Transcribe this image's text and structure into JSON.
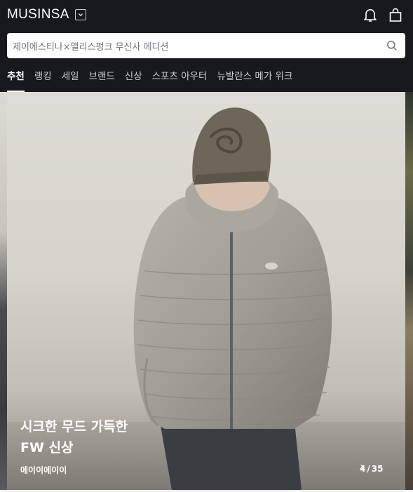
{
  "header": {
    "logo": "MUSINSA",
    "icons": [
      "chevron-down-icon",
      "bell-icon",
      "shopping-bag-icon"
    ]
  },
  "search": {
    "placeholder": "제이에스티나×앨리스펑크 무신사 에디션"
  },
  "tabs": [
    {
      "label": "추천",
      "active": true
    },
    {
      "label": "랭킹",
      "active": false
    },
    {
      "label": "세일",
      "active": false
    },
    {
      "label": "브랜드",
      "active": false
    },
    {
      "label": "신상",
      "active": false
    },
    {
      "label": "스포츠 아우터",
      "active": false
    },
    {
      "label": "뉴발란스 메가 위크",
      "active": false
    }
  ],
  "banner": {
    "title_line1": "시크한 무드 가득한",
    "title_line2": "FW 신상",
    "brand": "에이이에이이",
    "current": "4",
    "separator": "/",
    "total": "35"
  },
  "colors": {
    "header_bg": "#17191d",
    "text_white": "#ffffff",
    "tab_inactive": "#c9cbd0",
    "placeholder": "#6f7379"
  }
}
